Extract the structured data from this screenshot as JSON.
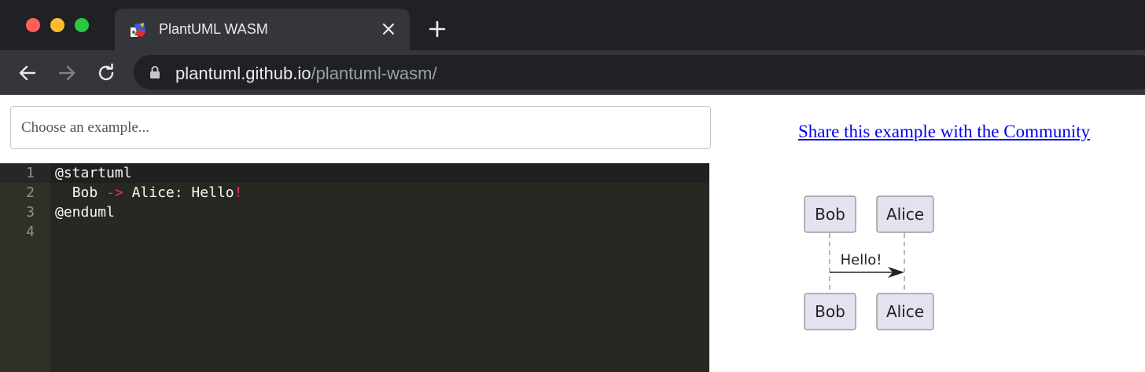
{
  "window": {
    "tab_title": "PlantUML WASM",
    "address": {
      "host": "plantuml.github.io",
      "path": "/plantuml-wasm/"
    }
  },
  "page": {
    "example_select": {
      "placeholder": "Choose an example..."
    },
    "share_link": "Share this example with the Community"
  },
  "editor": {
    "lines": [
      {
        "num": "1",
        "text": "@startuml"
      },
      {
        "num": "2",
        "indent": "  ",
        "from": "Bob",
        "arrow": "->",
        "rest": "Alice: Hello",
        "bang": "!"
      },
      {
        "num": "3",
        "text": "@enduml"
      },
      {
        "num": "4",
        "text": ""
      }
    ]
  },
  "diagram": {
    "participants": [
      "Bob",
      "Alice"
    ],
    "message": "Hello!"
  },
  "colors": {
    "chrome_bg": "#202124",
    "tab_bg": "#35363a",
    "editor_bg": "#272822",
    "keyword_pink": "#f92672",
    "participant_fill": "#e2e2f0",
    "link_blue": "#0000ee"
  }
}
